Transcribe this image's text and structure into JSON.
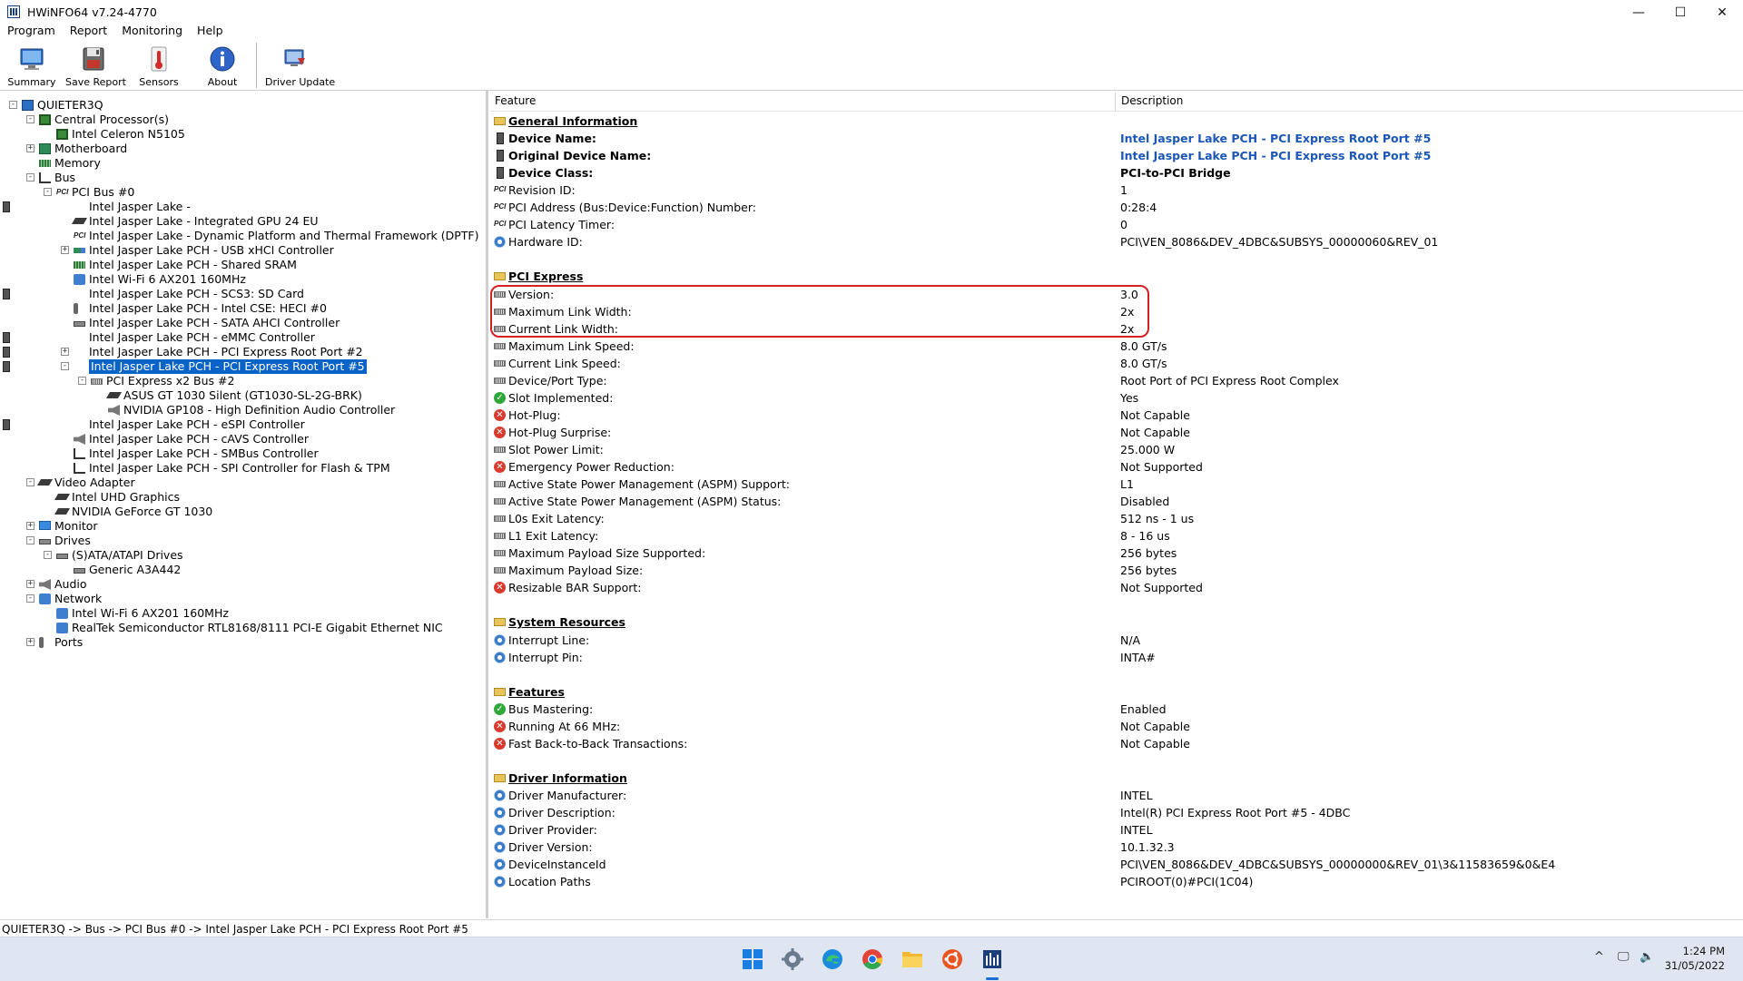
{
  "window": {
    "title": "HWiNFO64 v7.24-4770",
    "min": "—",
    "max": "☐",
    "close": "✕"
  },
  "menu": [
    "Program",
    "Report",
    "Monitoring",
    "Help"
  ],
  "toolbar": [
    "Summary",
    "Save Report",
    "Sensors",
    "About",
    "Driver Update"
  ],
  "tree": [
    {
      "text": "QUIETER3Q",
      "level": 0,
      "exp": "-",
      "icon": "computer-icon"
    },
    {
      "text": "Central Processor(s)",
      "level": 1,
      "exp": "-",
      "icon": "cpu-icon"
    },
    {
      "text": "Intel Celeron N5105",
      "level": 2,
      "exp": "",
      "icon": "cpu-icon"
    },
    {
      "text": "Motherboard",
      "level": 1,
      "exp": "+",
      "icon": "motherboard-icon"
    },
    {
      "text": "Memory",
      "level": 1,
      "exp": "",
      "icon": "memory-icon"
    },
    {
      "text": "Bus",
      "level": 1,
      "exp": "-",
      "icon": "bus-icon"
    },
    {
      "text": "PCI Bus #0",
      "level": 2,
      "exp": "-",
      "icon": "pci-icon"
    },
    {
      "text": "Intel Jasper Lake -",
      "level": 3,
      "exp": "",
      "icon": "chip-icon"
    },
    {
      "text": "Intel Jasper Lake - Integrated GPU 24 EU",
      "level": 3,
      "exp": "",
      "icon": "gpu-icon"
    },
    {
      "text": "Intel Jasper Lake - Dynamic Platform and Thermal Framework (DPTF)",
      "level": 3,
      "exp": "",
      "icon": "pci-icon"
    },
    {
      "text": "Intel Jasper Lake PCH - USB xHCI Controller",
      "level": 3,
      "exp": "+",
      "icon": "usb-icon"
    },
    {
      "text": "Intel Jasper Lake PCH - Shared SRAM",
      "level": 3,
      "exp": "",
      "icon": "memory-icon"
    },
    {
      "text": "Intel Wi-Fi 6 AX201 160MHz",
      "level": 3,
      "exp": "",
      "icon": "network-icon"
    },
    {
      "text": "Intel Jasper Lake PCH - SCS3: SD Card",
      "level": 3,
      "exp": "",
      "icon": "chip-icon"
    },
    {
      "text": "Intel Jasper Lake PCH - Intel CSE: HECI #0",
      "level": 3,
      "exp": "",
      "icon": "plug-icon"
    },
    {
      "text": "Intel Jasper Lake PCH - SATA AHCI Controller",
      "level": 3,
      "exp": "",
      "icon": "drive-icon"
    },
    {
      "text": "Intel Jasper Lake PCH - eMMC Controller",
      "level": 3,
      "exp": "",
      "icon": "chip-icon"
    },
    {
      "text": "Intel Jasper Lake PCH - PCI Express Root Port #2",
      "level": 3,
      "exp": "+",
      "icon": "chip-icon"
    },
    {
      "text": "Intel Jasper Lake PCH - PCI Express Root Port #5",
      "level": 3,
      "exp": "-",
      "icon": "chip-icon",
      "selected": true
    },
    {
      "text": "PCI Express x2 Bus #2",
      "level": 4,
      "exp": "-",
      "icon": "slot-icon"
    },
    {
      "text": "ASUS GT 1030 Silent (GT1030-SL-2G-BRK)",
      "level": 5,
      "exp": "",
      "icon": "gpu-icon"
    },
    {
      "text": "NVIDIA GP108 - High Definition Audio Controller",
      "level": 5,
      "exp": "",
      "icon": "audio-icon"
    },
    {
      "text": "Intel Jasper Lake PCH - eSPI Controller",
      "level": 3,
      "exp": "",
      "icon": "chip-icon"
    },
    {
      "text": "Intel Jasper Lake PCH - cAVS Controller",
      "level": 3,
      "exp": "",
      "icon": "audio-icon"
    },
    {
      "text": "Intel Jasper Lake PCH - SMBus Controller",
      "level": 3,
      "exp": "",
      "icon": "bus-icon"
    },
    {
      "text": "Intel Jasper Lake PCH - SPI Controller for Flash & TPM",
      "level": 3,
      "exp": "",
      "icon": "bus-icon"
    },
    {
      "text": "Video Adapter",
      "level": 1,
      "exp": "-",
      "icon": "gpu-icon"
    },
    {
      "text": "Intel UHD Graphics",
      "level": 2,
      "exp": "",
      "icon": "gpu-icon"
    },
    {
      "text": "NVIDIA GeForce GT 1030",
      "level": 2,
      "exp": "",
      "icon": "gpu-icon"
    },
    {
      "text": "Monitor",
      "level": 1,
      "exp": "+",
      "icon": "monitor-icon"
    },
    {
      "text": "Drives",
      "level": 1,
      "exp": "-",
      "icon": "drive-icon"
    },
    {
      "text": "(S)ATA/ATAPI Drives",
      "level": 2,
      "exp": "-",
      "icon": "drive-icon"
    },
    {
      "text": "Generic A3A442",
      "level": 3,
      "exp": "",
      "icon": "drive-icon"
    },
    {
      "text": "Audio",
      "level": 1,
      "exp": "+",
      "icon": "audio-icon"
    },
    {
      "text": "Network",
      "level": 1,
      "exp": "-",
      "icon": "network-icon"
    },
    {
      "text": "Intel Wi-Fi 6 AX201 160MHz",
      "level": 2,
      "exp": "",
      "icon": "network-icon"
    },
    {
      "text": "RealTek Semiconductor RTL8168/8111 PCI-E Gigabit Ethernet NIC",
      "level": 2,
      "exp": "",
      "icon": "network-icon"
    },
    {
      "text": "Ports",
      "level": 1,
      "exp": "+",
      "icon": "plug-icon"
    }
  ],
  "details": {
    "col_feature": "Feature",
    "col_description": "Description",
    "rows": [
      {
        "kind": "section",
        "feature": "General Information",
        "icon": "folder"
      },
      {
        "feature": "Device Name:",
        "value": "Intel Jasper Lake PCH - PCI Express Root Port #5",
        "icon": "chip",
        "bold": true,
        "link": true
      },
      {
        "feature": "Original Device Name:",
        "value": "Intel Jasper Lake PCH - PCI Express Root Port #5",
        "icon": "chip",
        "bold": true,
        "link": true
      },
      {
        "feature": "Device Class:",
        "value": "PCI-to-PCI Bridge",
        "icon": "chip",
        "bold": true
      },
      {
        "feature": "Revision ID:",
        "value": "1",
        "icon": "pci"
      },
      {
        "feature": "PCI Address (Bus:Device:Function) Number:",
        "value": "0:28:4",
        "icon": "pci"
      },
      {
        "feature": "PCI Latency Timer:",
        "value": "0",
        "icon": "pci"
      },
      {
        "feature": "Hardware ID:",
        "value": "PCI\\VEN_8086&DEV_4DBC&SUBSYS_00000060&REV_01",
        "icon": "gear"
      },
      {
        "kind": "blank"
      },
      {
        "kind": "section",
        "feature": "PCI Express",
        "icon": "folder"
      },
      {
        "feature": "Version:",
        "value": "3.0",
        "icon": "slot"
      },
      {
        "feature": "Maximum Link Width:",
        "value": "2x",
        "icon": "slot"
      },
      {
        "feature": "Current Link Width:",
        "value": "2x",
        "icon": "slot"
      },
      {
        "feature": "Maximum Link Speed:",
        "value": "8.0 GT/s",
        "icon": "slot"
      },
      {
        "feature": "Current Link Speed:",
        "value": "8.0 GT/s",
        "icon": "slot"
      },
      {
        "feature": "Device/Port Type:",
        "value": "Root Port of PCI Express Root Complex",
        "icon": "slot"
      },
      {
        "feature": "Slot Implemented:",
        "value": "Yes",
        "icon": "ok"
      },
      {
        "feature": "Hot-Plug:",
        "value": "Not Capable",
        "icon": "no"
      },
      {
        "feature": "Hot-Plug Surprise:",
        "value": "Not Capable",
        "icon": "no"
      },
      {
        "feature": "Slot Power Limit:",
        "value": "25.000 W",
        "icon": "slot"
      },
      {
        "feature": "Emergency Power Reduction:",
        "value": "Not Supported",
        "icon": "no"
      },
      {
        "feature": "Active State Power Management (ASPM) Support:",
        "value": "L1",
        "icon": "slot"
      },
      {
        "feature": "Active State Power Management (ASPM) Status:",
        "value": "Disabled",
        "icon": "slot"
      },
      {
        "feature": "L0s Exit Latency:",
        "value": "512 ns - 1 us",
        "icon": "slot"
      },
      {
        "feature": "L1 Exit Latency:",
        "value": "8 - 16 us",
        "icon": "slot"
      },
      {
        "feature": "Maximum Payload Size Supported:",
        "value": "256 bytes",
        "icon": "slot"
      },
      {
        "feature": "Maximum Payload Size:",
        "value": "256 bytes",
        "icon": "slot"
      },
      {
        "feature": "Resizable BAR Support:",
        "value": "Not Supported",
        "icon": "no"
      },
      {
        "kind": "blank"
      },
      {
        "kind": "section",
        "feature": "System Resources",
        "icon": "folder"
      },
      {
        "feature": "Interrupt Line:",
        "value": "N/A",
        "icon": "gear"
      },
      {
        "feature": "Interrupt Pin:",
        "value": "INTA#",
        "icon": "gear"
      },
      {
        "kind": "blank"
      },
      {
        "kind": "section",
        "feature": "Features",
        "icon": "folder"
      },
      {
        "feature": "Bus Mastering:",
        "value": "Enabled",
        "icon": "ok"
      },
      {
        "feature": "Running At 66 MHz:",
        "value": "Not Capable",
        "icon": "no"
      },
      {
        "feature": "Fast Back-to-Back Transactions:",
        "value": "Not Capable",
        "icon": "no"
      },
      {
        "kind": "blank"
      },
      {
        "kind": "section",
        "feature": "Driver Information",
        "icon": "folder"
      },
      {
        "feature": "Driver Manufacturer:",
        "value": "INTEL",
        "icon": "gear"
      },
      {
        "feature": "Driver Description:",
        "value": "Intel(R) PCI Express Root Port #5 - 4DBC",
        "icon": "gear"
      },
      {
        "feature": "Driver Provider:",
        "value": "INTEL",
        "icon": "gear"
      },
      {
        "feature": "Driver Version:",
        "value": "10.1.32.3",
        "icon": "gear"
      },
      {
        "feature": "DeviceInstanceId",
        "value": "PCI\\VEN_8086&DEV_4DBC&SUBSYS_00000000&REV_01\\3&11583659&0&E4",
        "icon": "gear"
      },
      {
        "feature": "Location Paths",
        "value": "PCIROOT(0)#PCI(1C04)",
        "icon": "gear"
      }
    ]
  },
  "statusbar": {
    "text": "QUIETER3Q -> Bus -> PCI Bus #0 -> Intel Jasper Lake PCH - PCI Express Root Port #5"
  },
  "taskbar": {
    "apps": [
      "start-icon",
      "settings-icon",
      "edge-icon",
      "chrome-icon",
      "file-explorer-icon",
      "ubuntu-icon",
      "hwinfo-icon"
    ],
    "tray": {
      "chevron": "^",
      "network": "🖵",
      "volume": "🔈"
    },
    "time": "1:24 PM",
    "date": "31/05/2022"
  },
  "colors": {
    "accent": "#0a64c8",
    "link": "#1c57b8",
    "highlight": "#d61f1f"
  }
}
